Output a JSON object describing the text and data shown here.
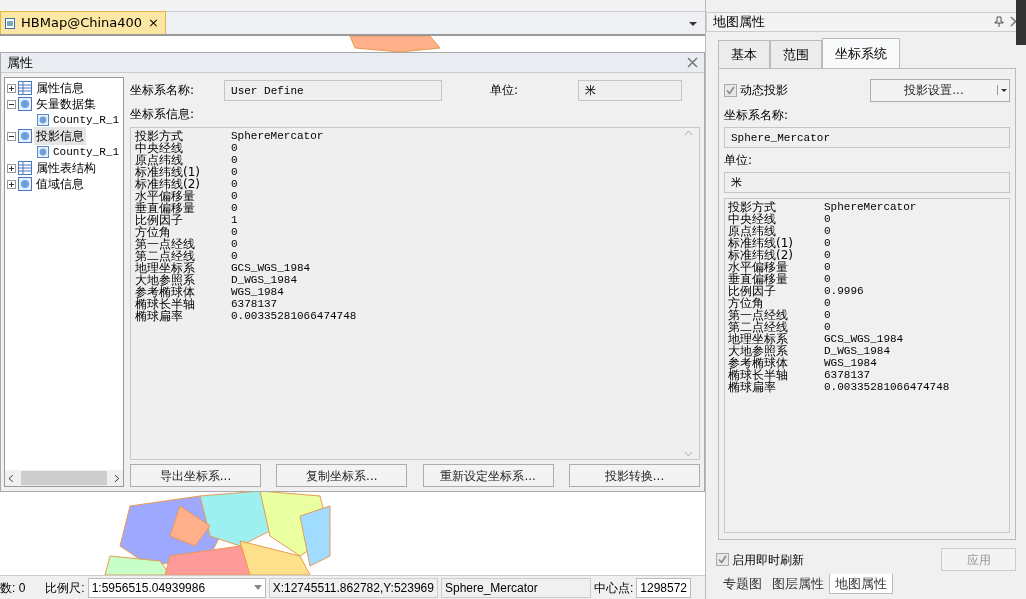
{
  "document_tab": {
    "title": "HBMap@China400",
    "close": "×",
    "selected": true
  },
  "properties_dialog": {
    "title": "属性",
    "tree": [
      {
        "label": "属性信息",
        "expanded": false,
        "selected": false
      },
      {
        "label": "矢量数据集",
        "expanded": true,
        "selected": false,
        "children": [
          {
            "label": "County_R_1",
            "selected": false
          }
        ]
      },
      {
        "label": "投影信息",
        "expanded": true,
        "selected": true,
        "children": [
          {
            "label": "County_R_1",
            "selected": false
          }
        ]
      },
      {
        "label": "属性表结构",
        "expanded": false,
        "selected": false
      },
      {
        "label": "值域信息",
        "expanded": false,
        "selected": false
      }
    ],
    "name_label": "坐标系名称:",
    "name_value": "User Define",
    "unit_label": "单位:",
    "unit_value": "米",
    "info_label": "坐标系信息:",
    "info_rows": [
      {
        "label": "投影方式",
        "value": "SphereMercator"
      },
      {
        "label": "中央经线",
        "value": "0"
      },
      {
        "label": "原点纬线",
        "value": "0"
      },
      {
        "label": "标准纬线(1)",
        "value": "0"
      },
      {
        "label": "标准纬线(2)",
        "value": "0"
      },
      {
        "label": "水平偏移量",
        "value": "0"
      },
      {
        "label": "垂直偏移量",
        "value": "0"
      },
      {
        "label": "比例因子",
        "value": "1"
      },
      {
        "label": "方位角",
        "value": "0"
      },
      {
        "label": "第一点经线",
        "value": "0"
      },
      {
        "label": "第二点经线",
        "value": "0"
      },
      {
        "label": "地理坐标系",
        "value": "GCS_WGS_1984"
      },
      {
        "label": "大地参照系",
        "value": "D_WGS_1984"
      },
      {
        "label": "参考椭球体",
        "value": "WGS_1984"
      },
      {
        "label": "椭球长半轴",
        "value": "6378137"
      },
      {
        "label": "椭球扁率",
        "value": "0.00335281066474748"
      }
    ],
    "buttons": [
      "导出坐标系...",
      "复制坐标系...",
      "重新设定坐标系...",
      "投影转换..."
    ]
  },
  "status_bar": {
    "count": "数: 0",
    "scale_label": "比例尺:",
    "scale_value": "1:5956515.04939986",
    "coordinates": "X:12745511.862782,Y:523969",
    "projection": "Sphere_Mercator",
    "center_label": "中心点:",
    "center_value": "1298572"
  },
  "map_properties": {
    "title": "地图属性",
    "tabs": [
      {
        "label": "基本",
        "selected": false
      },
      {
        "label": "范围",
        "selected": false
      },
      {
        "label": "坐标系统",
        "selected": true
      }
    ],
    "dynamic_projection": {
      "label": "动态投影",
      "checked": true
    },
    "projection_settings": "投影设置...",
    "name_label": "坐标系名称:",
    "name_value": "Sphere_Mercator",
    "unit_label": "单位:",
    "unit_value": "米",
    "info_rows": [
      {
        "label": "投影方式",
        "value": "SphereMercator"
      },
      {
        "label": "中央经线",
        "value": "0"
      },
      {
        "label": "原点纬线",
        "value": "0"
      },
      {
        "label": "标准纬线(1)",
        "value": "0"
      },
      {
        "label": "标准纬线(2)",
        "value": "0"
      },
      {
        "label": "水平偏移量",
        "value": "0"
      },
      {
        "label": "垂直偏移量",
        "value": "0"
      },
      {
        "label": "比例因子",
        "value": "0.9996"
      },
      {
        "label": "方位角",
        "value": "0"
      },
      {
        "label": "第一点经线",
        "value": "0"
      },
      {
        "label": "第二点经线",
        "value": "0"
      },
      {
        "label": "地理坐标系",
        "value": "GCS_WGS_1984"
      },
      {
        "label": "大地参照系",
        "value": "D_WGS_1984"
      },
      {
        "label": "参考椭球体",
        "value": "WGS_1984"
      },
      {
        "label": "椭球长半轴",
        "value": "6378137"
      },
      {
        "label": "椭球扁率",
        "value": "0.00335281066474748"
      }
    ],
    "realtime_refresh": {
      "label": "启用即时刷新",
      "checked": true
    },
    "apply": {
      "label": "应用",
      "disabled": true
    },
    "bottom_tabs": [
      {
        "label": "专题图",
        "selected": false
      },
      {
        "label": "图层属性",
        "selected": false
      },
      {
        "label": "地图属性",
        "selected": true
      }
    ]
  }
}
